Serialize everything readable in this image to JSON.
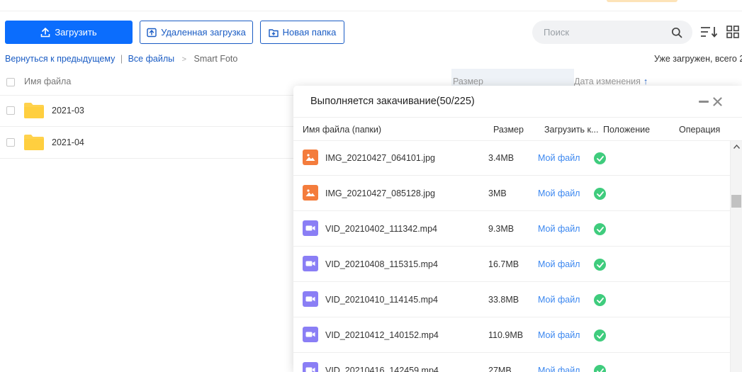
{
  "toolbar": {
    "upload_label": "Загрузить",
    "remote_label": "Удаленная загрузка",
    "new_folder_label": "Новая папка",
    "search_placeholder": "Поиск"
  },
  "breadcrumb": {
    "back": "Вернуться к предыдущему",
    "separator": "|",
    "all_files": "Все файлы",
    "arrow": ">",
    "current": "Smart Foto"
  },
  "status_text": "Уже загружен, всего 2",
  "file_list": {
    "headers": {
      "name": "Имя файла",
      "size": "Размер",
      "date": "Дата изменения"
    },
    "sort_indicator": "↑",
    "rows": [
      {
        "name": "2021-03",
        "icon": "folder-icon"
      },
      {
        "name": "2021-04",
        "icon": "folder-icon"
      }
    ]
  },
  "download_panel": {
    "title": "Выполняется закачивание(50/225)",
    "headers": {
      "name": "Имя файла (папки)",
      "size": "Размер",
      "upload_to": "Загрузить к...",
      "position": "Положение",
      "operation": "Операция"
    },
    "rows": [
      {
        "name": "IMG_20210427_064101.jpg",
        "size": "3.4MB",
        "dest": "Мой файл",
        "type": "image"
      },
      {
        "name": "IMG_20210427_085128.jpg",
        "size": "3MB",
        "dest": "Мой файл",
        "type": "image"
      },
      {
        "name": "VID_20210402_111342.mp4",
        "size": "9.3MB",
        "dest": "Мой файл",
        "type": "video"
      },
      {
        "name": "VID_20210408_115315.mp4",
        "size": "16.7MB",
        "dest": "Мой файл",
        "type": "video"
      },
      {
        "name": "VID_20210410_114145.mp4",
        "size": "33.8MB",
        "dest": "Мой файл",
        "type": "video"
      },
      {
        "name": "VID_20210412_140152.mp4",
        "size": "110.9MB",
        "dest": "Мой файл",
        "type": "video"
      },
      {
        "name": "VID_20210416_142459.mp4",
        "size": "27MB",
        "dest": "Мой файл",
        "type": "video"
      }
    ]
  },
  "colors": {
    "primary": "#0b6dfd",
    "link": "#3b87f0",
    "success": "#3fcc7d",
    "image_icon": "#f47c3c",
    "video_icon": "#8a7ef5",
    "folder": "#ffd24d"
  }
}
